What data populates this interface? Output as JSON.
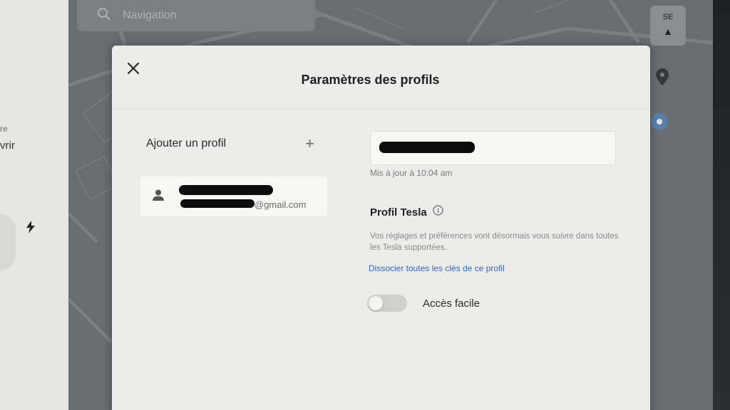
{
  "background": {
    "navigation_placeholder": "Navigation",
    "compass_label": "SE",
    "left_fragments": [
      "re",
      "vrir"
    ]
  },
  "modal": {
    "title": "Paramètres des profils",
    "add_profile_label": "Ajouter un profil",
    "profile_email_suffix": "@gmail.com",
    "updated_text": "Mis à jour à 10:04 am",
    "tesla_profile_title": "Profil Tesla",
    "description": "Vos réglages et préférences vont désormais vous suivre dans toutes les Tesla supportées.",
    "unlink_link": "Dissocier toutes les clés de ce profil",
    "easy_entry_label": "Accès facile",
    "easy_entry_enabled": false
  },
  "icons": {
    "close": "close-icon",
    "add": "plus-icon",
    "avatar": "person-icon",
    "info": "info-icon",
    "search": "search-icon",
    "pin": "map-pin-icon",
    "locate": "locate-icon"
  },
  "colors": {
    "link": "#2f63c8",
    "modal_bg": "#ececeb",
    "map_bg": "#686d71"
  }
}
